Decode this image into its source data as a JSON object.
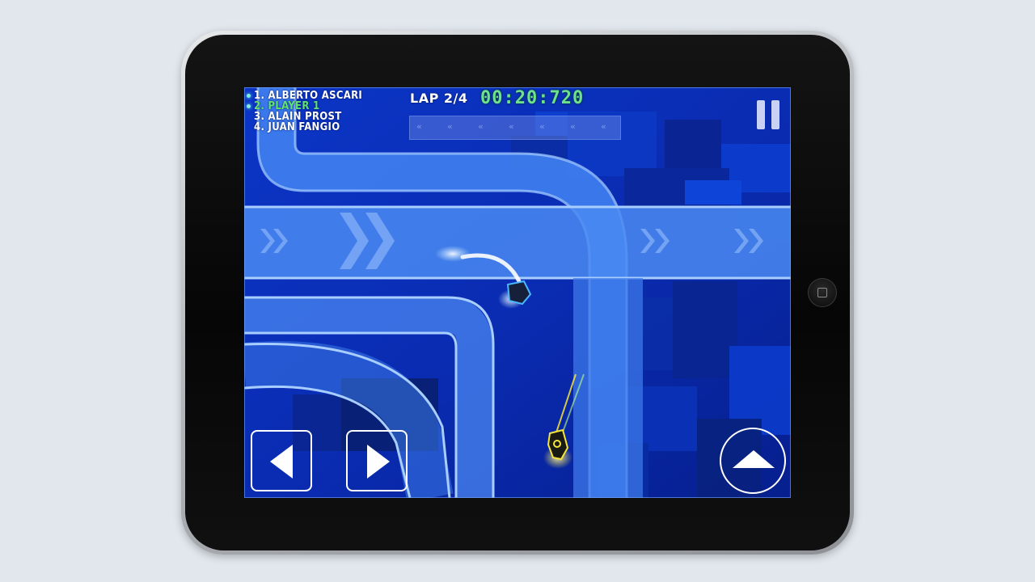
{
  "hud": {
    "standings": [
      {
        "text": "1. ALBERTO ASCARI",
        "is_player": false
      },
      {
        "text": "2. PLAYER 1",
        "is_player": true
      },
      {
        "text": "3. ALAIN PROST",
        "is_player": false
      },
      {
        "text": "4. JUAN FANGIO",
        "is_player": false
      }
    ],
    "lap": "LAP 2/4",
    "timer": "00:20:720",
    "progress_arrows": [
      "«",
      "«",
      "«",
      "«",
      "«",
      "«",
      "«"
    ]
  },
  "controls": {
    "pause": "pause-icon",
    "left": "arrow-left-icon",
    "right": "arrow-right-icon",
    "accelerate": "arrow-up-icon"
  },
  "colors": {
    "background": "#e1e7ed",
    "screen_base": "#0a2aa8",
    "track": "#3f7ff0",
    "timer_green": "#6ee28a",
    "player_green": "#5ee36e",
    "rival_car_glow": "#bfe6ff",
    "player_car_glow": "#f5e43a"
  }
}
